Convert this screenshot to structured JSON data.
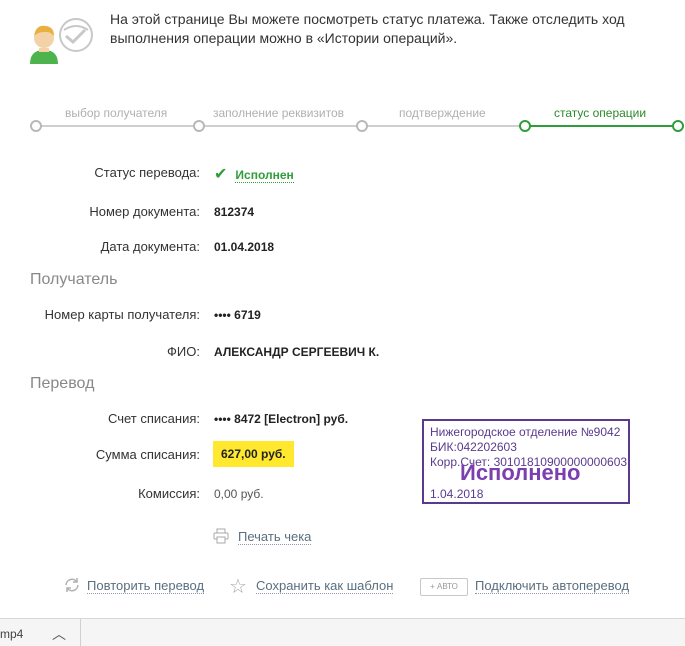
{
  "intro": {
    "text": "На этой странице Вы можете посмотреть статус платежа. Также отследить ход выполнения операции можно в «Истории операций»."
  },
  "steps": [
    {
      "label": "выбор получателя",
      "active": false
    },
    {
      "label": "заполнение реквизитов",
      "active": false
    },
    {
      "label": "подтверждение",
      "active": false
    },
    {
      "label": "статус операции",
      "active": true
    }
  ],
  "details": {
    "status_label": "Статус перевода:",
    "status_value": "Исполнен",
    "doc_number_label": "Номер документа:",
    "doc_number_value": "812374",
    "doc_date_label": "Дата документа:",
    "doc_date_value": "01.04.2018"
  },
  "recipient": {
    "section_title": "Получатель",
    "card_label": "Номер карты получателя:",
    "card_value": "•••• 6719",
    "name_label": "ФИО:",
    "name_value": "АЛЕКСАНДР СЕРГЕЕВИЧ К."
  },
  "transfer": {
    "section_title": "Перевод",
    "account_label": "Счет списания:",
    "account_value": "•••• 8472  [Electron]  руб.",
    "amount_label": "Сумма списания:",
    "amount_value": "627,00  руб.",
    "fee_label": "Комиссия:",
    "fee_value": "0,00 руб."
  },
  "stamp": {
    "line1": "Нижегородское отделение №9042",
    "line2": "БИК:042202603",
    "line3": "Корр.Счет: 30101810900000000603",
    "status": "Исполнено",
    "date": "1.04.2018"
  },
  "actions": {
    "print": "Печать чека",
    "repeat": "Повторить перевод",
    "save_template": "Сохранить как шаблон",
    "auto_badge": "+ АВТО",
    "auto_transfer": "Подключить автоперевод"
  },
  "download_bar": {
    "file": "mp4"
  },
  "colors": {
    "accent_green": "#2e9d3a",
    "highlight_yellow": "#ffe82e",
    "stamp_purple": "#5b3a8e"
  }
}
